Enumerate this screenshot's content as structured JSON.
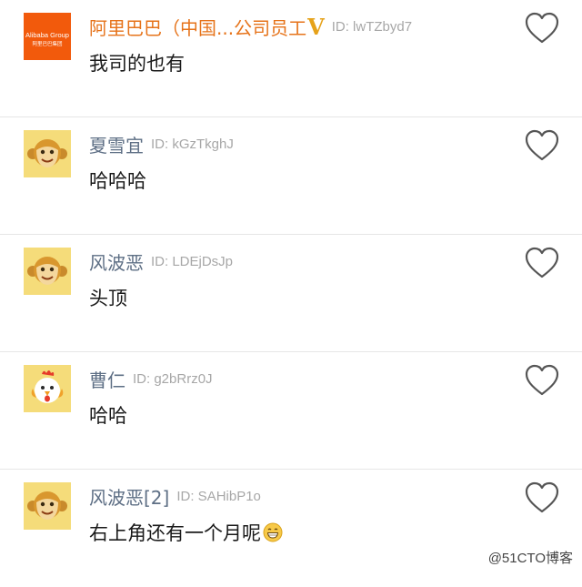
{
  "comments": [
    {
      "name": "阿里巴巴（中国...公司员工",
      "verified_badge": "V",
      "uid": "ID: lwTZbyd7",
      "text": "我司的也有",
      "avatar": "alibaba-group-logo-avatar",
      "avatar_text": "Alibaba Group",
      "avatar_subtext": "阿里巴巴集团",
      "like_icon": "heart-outline-icon"
    },
    {
      "name": "夏雪宜",
      "uid": "ID: kGzTkghJ",
      "text": "哈哈哈",
      "avatar": "monkey-avatar",
      "like_icon": "heart-outline-icon"
    },
    {
      "name": "风波恶",
      "uid": "ID: LDEjDsJp",
      "text": "头顶",
      "avatar": "monkey-avatar",
      "like_icon": "heart-outline-icon"
    },
    {
      "name": "曹仁",
      "uid": "ID: g2bRrz0J",
      "text": "哈哈",
      "avatar": "rooster-avatar",
      "like_icon": "heart-outline-icon"
    },
    {
      "name": "风波恶[2]",
      "uid": "ID: SAHibP1o",
      "text": "右上角还有一个月呢",
      "text_emoji": "grinning-face-emoji",
      "avatar": "monkey-avatar",
      "like_icon": "heart-outline-icon"
    }
  ],
  "watermark": "@51CTO博客",
  "colors": {
    "name": "#5e6f85",
    "vip_name": "#e6731a",
    "uid": "#a7a7a7",
    "divider": "#e6e6e6",
    "avatar_bg": "#f5dc7a",
    "alibaba_orange": "#f25a0c"
  }
}
